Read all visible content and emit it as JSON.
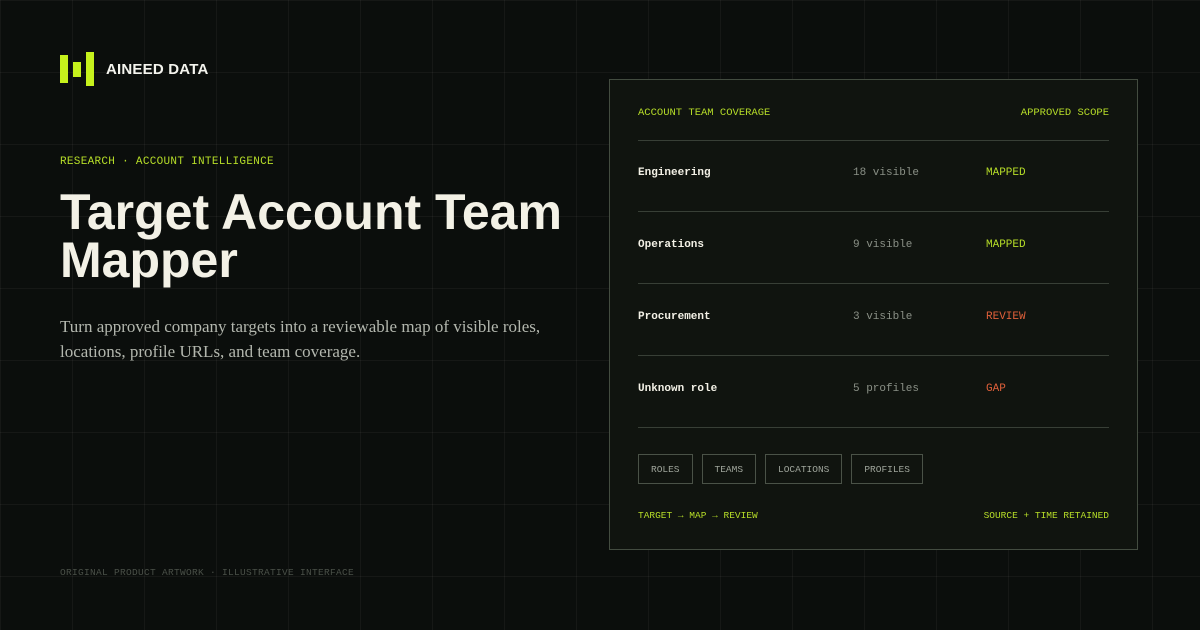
{
  "brand": {
    "name": "AINEED DATA",
    "logo_icon": "bar-logo-icon",
    "accent": "#c6f11c"
  },
  "hero": {
    "eyebrow": "RESEARCH · ACCOUNT INTELLIGENCE",
    "title": "Target Account Team Mapper",
    "description": "Turn approved company targets into a reviewable map of visible roles, locations, profile URLs, and team coverage."
  },
  "footnote": "ORIGINAL PRODUCT ARTWORK · ILLUSTRATIVE INTERFACE",
  "panel": {
    "header_left": "ACCOUNT TEAM COVERAGE",
    "header_right": "APPROVED SCOPE",
    "rows": [
      {
        "name": "Engineering",
        "count": "18 visible",
        "status": "MAPPED",
        "status_color": "#b6dd28"
      },
      {
        "name": "Operations",
        "count": "9 visible",
        "status": "MAPPED",
        "status_color": "#b6dd28"
      },
      {
        "name": "Procurement",
        "count": "3 visible",
        "status": "REVIEW",
        "status_color": "#e0603a"
      },
      {
        "name": "Unknown role",
        "count": "5 profiles",
        "status": "GAP",
        "status_color": "#e0603a"
      }
    ],
    "chips": [
      "ROLES",
      "TEAMS",
      "LOCATIONS",
      "PROFILES"
    ],
    "flow": "TARGET → MAP → REVIEW",
    "retained": "SOURCE + TIME RETAINED"
  }
}
